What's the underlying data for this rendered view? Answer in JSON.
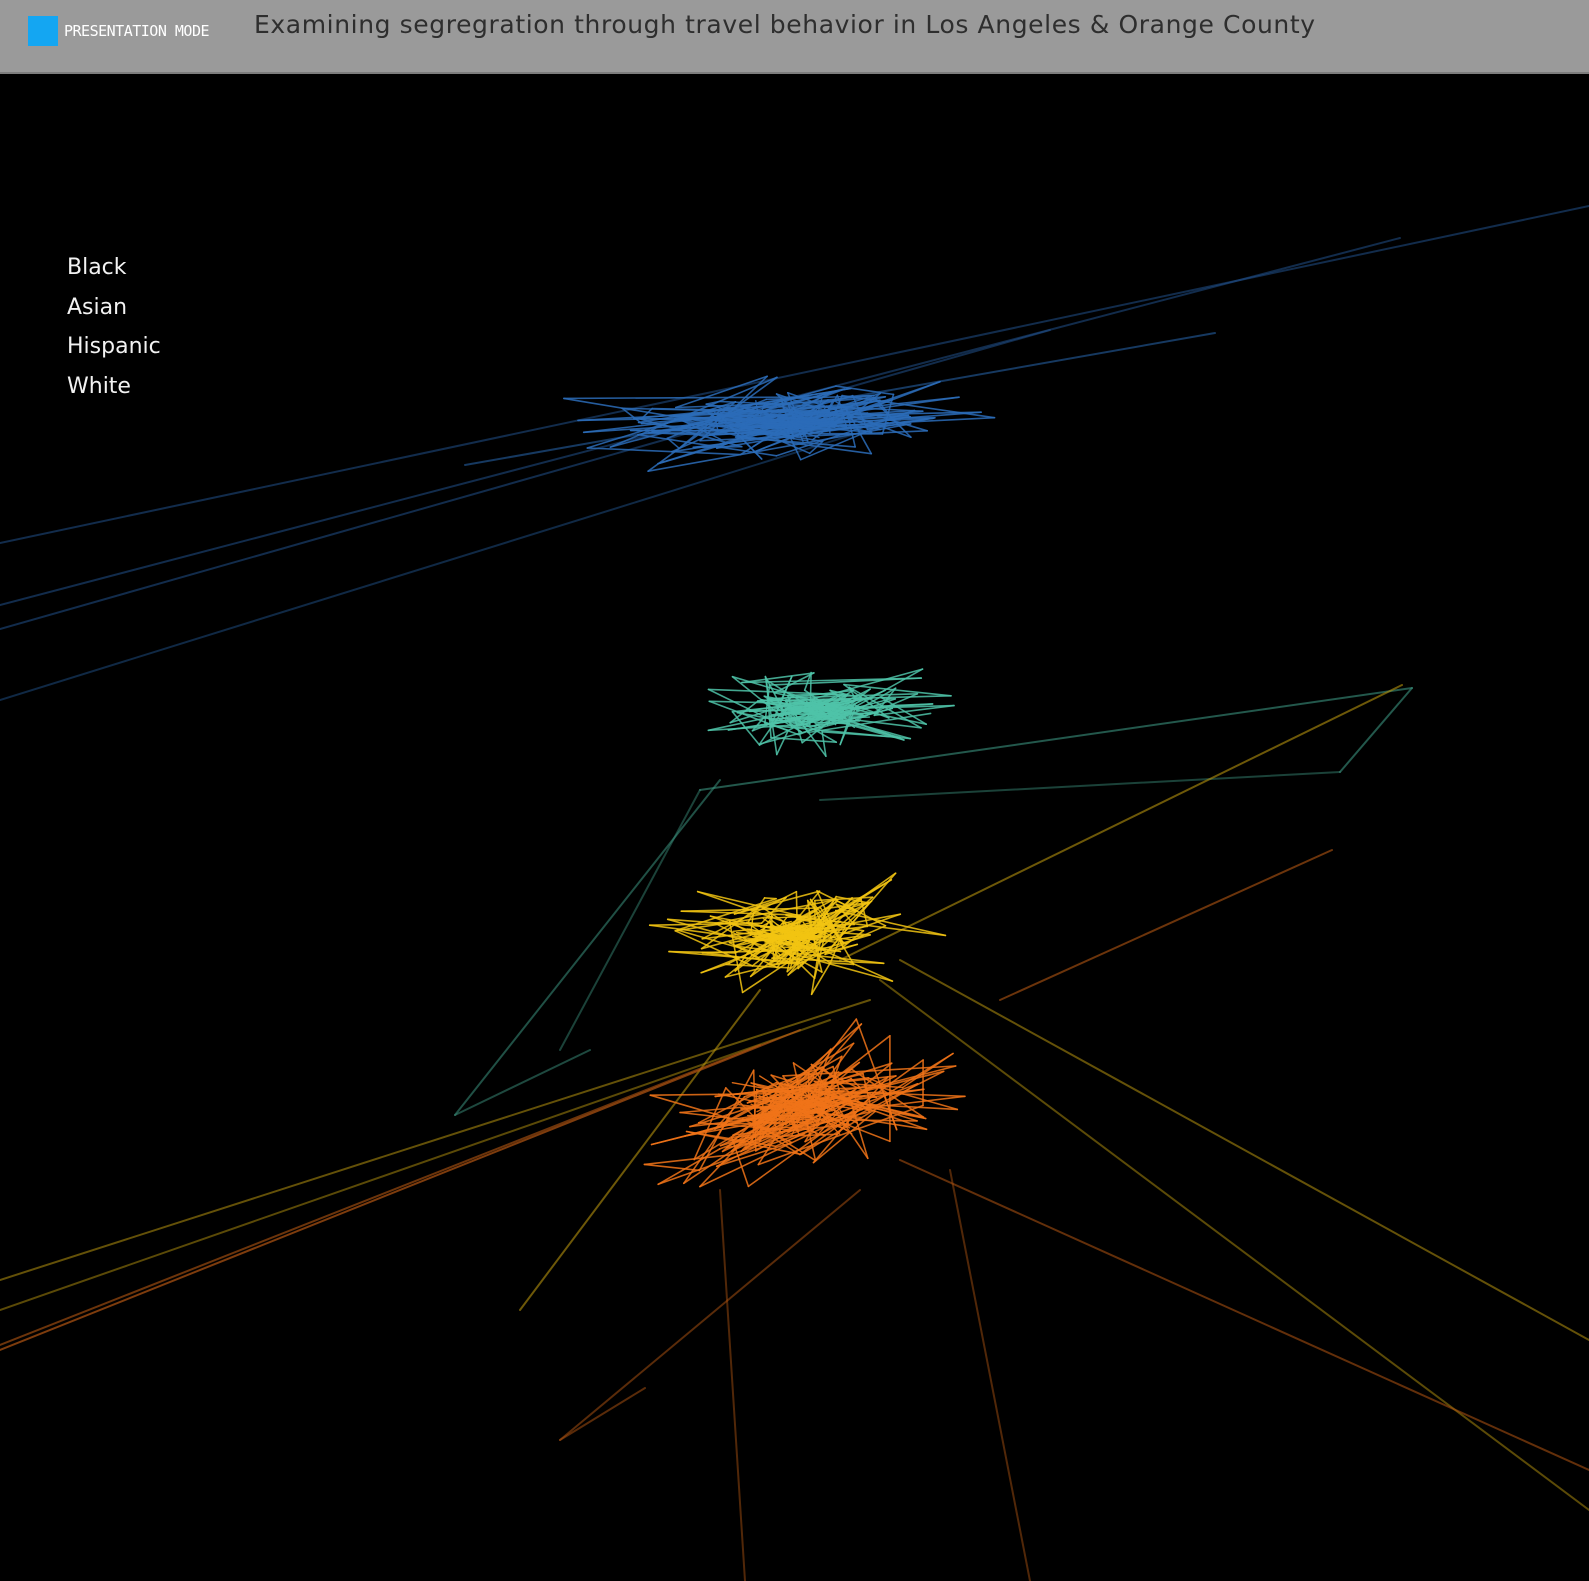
{
  "header": {
    "mode_label": "PRESENTATION MODE",
    "title": "Examining segregration through travel behavior in Los Angeles & Orange County",
    "mode_color": "#14a6f2"
  },
  "legend": {
    "items": [
      {
        "label": "Black"
      },
      {
        "label": "Asian"
      },
      {
        "label": "Hispanic"
      },
      {
        "label": "White"
      }
    ]
  },
  "visualization": {
    "type": "3d-trajectory-lines",
    "background": "#000000",
    "groups": [
      {
        "name": "Black",
        "color": "#2b6cb8"
      },
      {
        "name": "Asian",
        "color": "#4fc3a8"
      },
      {
        "name": "Hispanic",
        "color": "#f2c412"
      },
      {
        "name": "White",
        "color": "#f07318"
      }
    ]
  }
}
